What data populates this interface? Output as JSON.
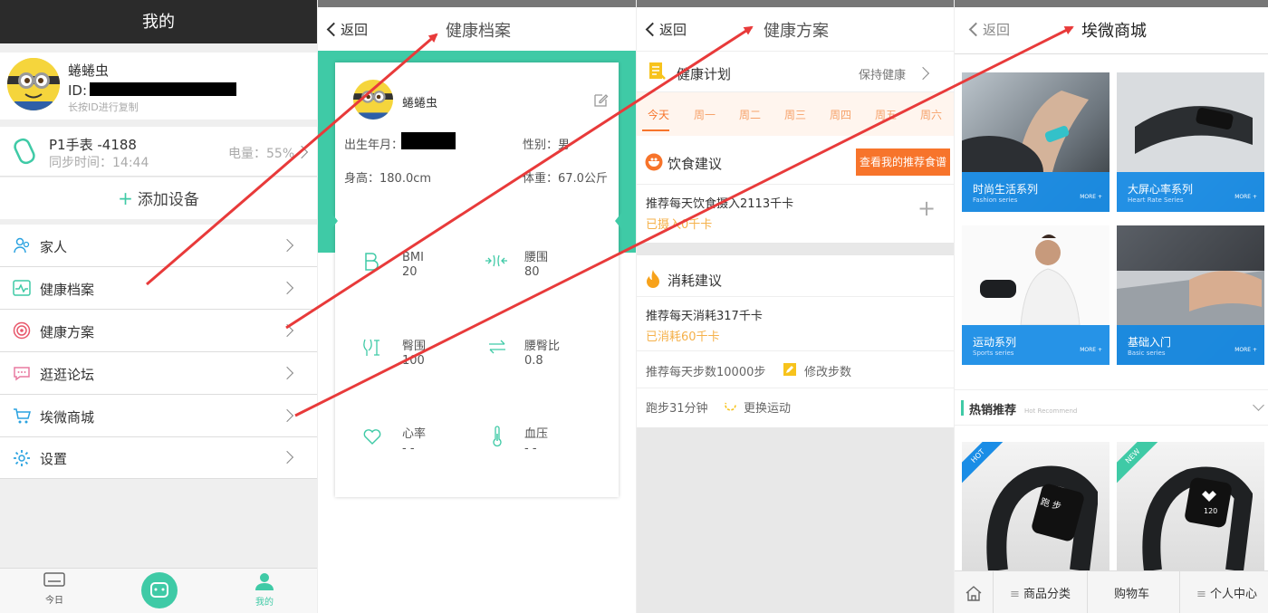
{
  "profile": {
    "header_title": "我的",
    "username": "蜷蜷虫",
    "id_label": "ID:",
    "id_hint": "长按ID进行复制",
    "device_name": "P1手表 -4188",
    "sync_time": "同步时间：14:44",
    "battery": "电量：55%",
    "add_device": "添加设备",
    "menu": [
      {
        "label": "家人",
        "icon": "family-icon"
      },
      {
        "label": "健康档案",
        "icon": "health-record-icon"
      },
      {
        "label": "健康方案",
        "icon": "target-icon"
      },
      {
        "label": "逛逛论坛",
        "icon": "chat-icon"
      },
      {
        "label": "埃微商城",
        "icon": "cart-icon"
      },
      {
        "label": "设置",
        "icon": "gear-icon"
      }
    ],
    "tabbar": {
      "today": "今日",
      "mine": "我的"
    }
  },
  "record": {
    "back": "返回",
    "title": "健康档案",
    "name": "蜷蜷虫",
    "birth_label": "出生年月：",
    "gender": "性别：男",
    "height": "身高：180.0cm",
    "weight": "体重：67.0公斤",
    "stats": [
      {
        "label": "BMI",
        "value": "20"
      },
      {
        "label": "腰围",
        "value": "80"
      },
      {
        "label": "臀围",
        "value": "100"
      },
      {
        "label": "腰臀比",
        "value": "0.8"
      },
      {
        "label": "心率",
        "value": "- -"
      },
      {
        "label": "血压",
        "value": "- -"
      }
    ]
  },
  "plan": {
    "back": "返回",
    "title": "健康方案",
    "plan_label": "健康计划",
    "plan_status": "保持健康",
    "days": [
      "今天",
      "周一",
      "周二",
      "周三",
      "周四",
      "周五",
      "周六"
    ],
    "diet_title": "饮食建议",
    "diet_button": "查看我的推荐食谱",
    "diet_intake": "推荐每天饮食摄入2113千卡",
    "diet_taken": "已摄入0千卡",
    "burn_title": "消耗建议",
    "burn_rec": "推荐每天消耗317千卡",
    "burn_done": "已消耗60千卡",
    "steps_rec": "推荐每天步数10000步",
    "edit_steps": "修改步数",
    "run": "跑步31分钟",
    "change_sport": "更换运动"
  },
  "shop": {
    "back": "返回",
    "title": "埃微商城",
    "products": [
      {
        "name": "时尚生活系列",
        "sub": "Fashion series",
        "more": "MORE +"
      },
      {
        "name": "大屏心率系列",
        "sub": "Heart Rate Series",
        "more": "MORE +"
      },
      {
        "name": "运动系列",
        "sub": "Sports series",
        "more": "MORE +"
      },
      {
        "name": "基础入门",
        "sub": "Basic series",
        "more": "MORE +"
      }
    ],
    "hot_title": "热销推荐",
    "hot_sub": "Hot Recommend",
    "badge_hot": "HOT",
    "badge_new": "NEW",
    "band1_text": "跑 步",
    "band2_text": "120",
    "tabs": [
      "商品分类",
      "购物车",
      "个人中心"
    ]
  },
  "colors": {
    "accent": "#3fcaa6",
    "orange": "#f7742b",
    "blue": "#1a8de6",
    "arrow": "#e83a3a"
  }
}
